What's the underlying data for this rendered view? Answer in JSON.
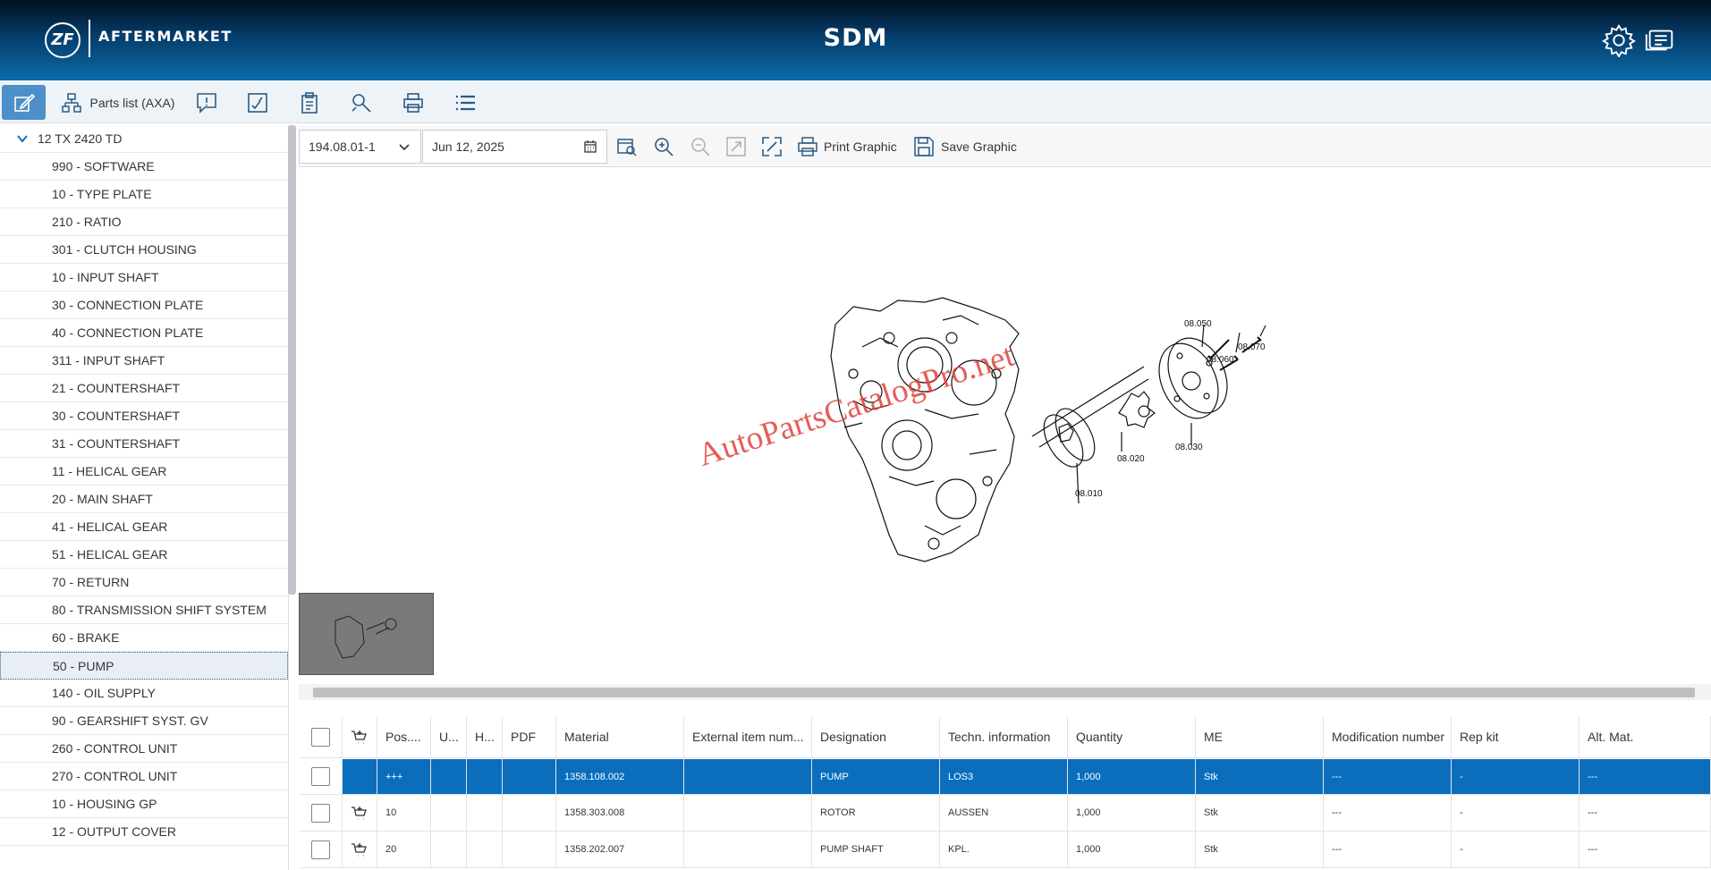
{
  "header": {
    "logo_mark": "ZF",
    "logo_text": "AFTERMARKET",
    "title": "SDM",
    "icons": [
      "gear-icon",
      "manual-icon"
    ]
  },
  "toolbar": {
    "parts_list_label": "Parts list (AXA)",
    "icons": [
      "edit-graphic-icon",
      "hierarchy-icon",
      "alert-icon",
      "checklist-icon",
      "clipboard-icon",
      "search-parts-icon",
      "print-icon",
      "list-icon"
    ]
  },
  "tree": {
    "root": "12 TX 2420 TD",
    "items": [
      "990 - SOFTWARE",
      "10 - TYPE PLATE",
      "210 - RATIO",
      "301 - CLUTCH HOUSING",
      "10 - INPUT SHAFT",
      "30 - CONNECTION PLATE",
      "40 - CONNECTION PLATE",
      "311 - INPUT SHAFT",
      "21 - COUNTERSHAFT",
      "30 - COUNTERSHAFT",
      "31 - COUNTERSHAFT",
      "11 - HELICAL GEAR",
      "20 - MAIN SHAFT",
      "41 - HELICAL GEAR",
      "51 - HELICAL GEAR",
      "70 - RETURN",
      "80 - TRANSMISSION SHIFT SYSTEM",
      "60 - BRAKE",
      "50 - PUMP",
      "140 - OIL SUPPLY",
      "90 - GEARSHIFT SYST. GV",
      "260 - CONTROL UNIT",
      "270 - CONTROL UNIT",
      "10 - HOUSING GP",
      "12 - OUTPUT COVER"
    ],
    "selected": "50 - PUMP"
  },
  "graphic_toolbar": {
    "variant": "194.08.01-1",
    "date": "Jun 12, 2025",
    "print_label": "Print Graphic",
    "save_label": "Save Graphic"
  },
  "graphic": {
    "watermark": "AutoPartsCatalogPro.net",
    "callouts": [
      "08.050",
      "08.070",
      "08.060",
      "08.030",
      "08.020",
      "08.010"
    ]
  },
  "table": {
    "columns": [
      "Pos....",
      "U...",
      "H...",
      "PDF",
      "Material",
      "External item num...",
      "Designation",
      "Techn. information",
      "Quantity",
      "ME",
      "Modification number",
      "Rep kit",
      "Alt. Mat."
    ],
    "rows": [
      {
        "pos": "+++",
        "u": "",
        "h": "",
        "pdf": "",
        "material": "1358.108.002",
        "ext": "",
        "designation": "PUMP",
        "techn": "LOS3",
        "quantity": "1,000",
        "me": "Stk",
        "mod": "---",
        "rep": "-",
        "alt": "---"
      },
      {
        "pos": "10",
        "u": "",
        "h": "",
        "pdf": "",
        "material": "1358.303.008",
        "ext": "",
        "designation": "ROTOR",
        "techn": "AUSSEN",
        "quantity": "1,000",
        "me": "Stk",
        "mod": "---",
        "rep": "-",
        "alt": "---"
      },
      {
        "pos": "20",
        "u": "",
        "h": "",
        "pdf": "",
        "material": "1358.202.007",
        "ext": "",
        "designation": "PUMP SHAFT",
        "techn": "KPL.",
        "quantity": "1,000",
        "me": "Stk",
        "mod": "---",
        "rep": "-",
        "alt": "---"
      }
    ]
  }
}
